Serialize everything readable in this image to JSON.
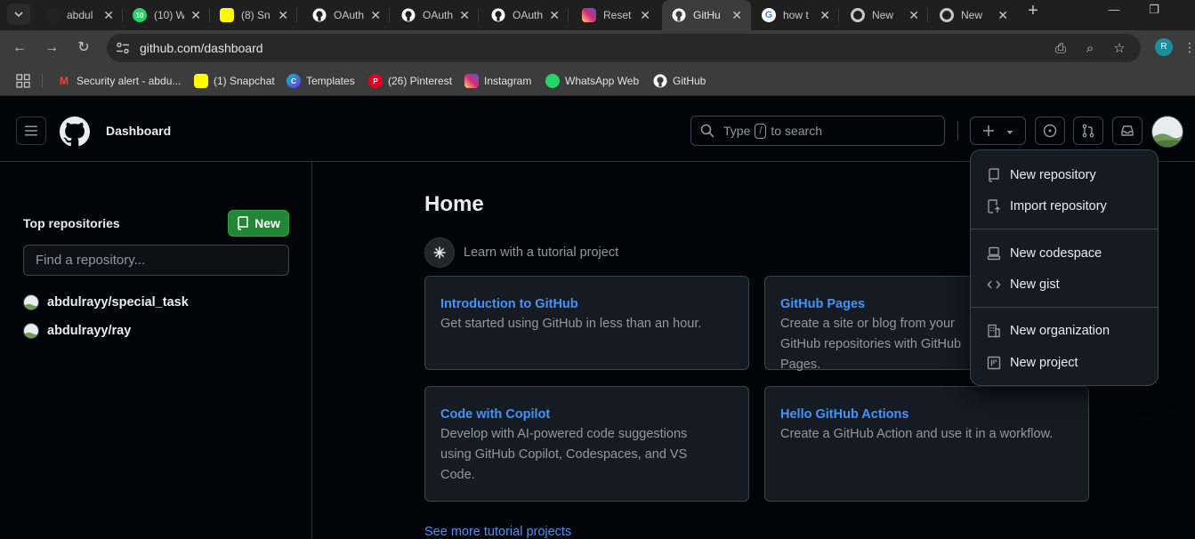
{
  "browser": {
    "tabs": [
      {
        "title": "abdul",
        "icon": "github-icon",
        "fav_color": "#111111",
        "badge": ""
      },
      {
        "title": "(10) W",
        "icon": "whatsapp-icon",
        "fav_color": "#25d366",
        "badge": "10"
      },
      {
        "title": "(8) Sn",
        "icon": "snapchat-icon",
        "fav_color": "#fffc00",
        "badge": ""
      },
      {
        "title": "OAuth",
        "icon": "github-icon",
        "fav_color": "#ffffff",
        "badge": ""
      },
      {
        "title": "OAuth",
        "icon": "github-icon",
        "fav_color": "#ffffff",
        "badge": ""
      },
      {
        "title": "OAuth",
        "icon": "github-icon",
        "fav_color": "#ffffff",
        "badge": ""
      },
      {
        "title": "Reset",
        "icon": "instagram-icon",
        "fav_color": "#d62976",
        "badge": ""
      },
      {
        "title": "GitHu",
        "icon": "github-icon",
        "fav_color": "#ffffff",
        "badge": "",
        "active": true
      },
      {
        "title": "how t",
        "icon": "google-icon",
        "fav_color": "#ffffff",
        "badge": ""
      },
      {
        "title": "New",
        "icon": "chrome-icon",
        "fav_color": "#c7c7c7",
        "badge": ""
      },
      {
        "title": "New",
        "icon": "chrome-icon",
        "fav_color": "#c7c7c7",
        "badge": ""
      }
    ],
    "url": "github.com/dashboard",
    "profile_initial": "R",
    "bookmarks": [
      {
        "label": "Security alert - abdu...",
        "icon": "gmail-icon"
      },
      {
        "label": "(1) Snapchat",
        "icon": "snapchat-icon"
      },
      {
        "label": "Templates",
        "icon": "canva-icon"
      },
      {
        "label": "(26) Pinterest",
        "icon": "pinterest-icon"
      },
      {
        "label": "Instagram",
        "icon": "instagram-icon"
      },
      {
        "label": "WhatsApp Web",
        "icon": "whatsapp-icon"
      },
      {
        "label": "GitHub",
        "icon": "github-icon"
      }
    ]
  },
  "header": {
    "context_title": "Dashboard",
    "search_prefix": "Type",
    "search_key": "/",
    "search_suffix": "to search"
  },
  "sidebar": {
    "title": "Top repositories",
    "new_button": "New",
    "find_placeholder": "Find a repository...",
    "repos": [
      {
        "owner": "abdulrayy",
        "name": "special_task"
      },
      {
        "owner": "abdulrayy",
        "name": "ray"
      }
    ]
  },
  "main": {
    "title": "Home",
    "learn_text": "Learn with a tutorial project",
    "cards": [
      {
        "title": "Introduction to GitHub",
        "desc": "Get started using GitHub in less than an hour."
      },
      {
        "title": "GitHub Pages",
        "desc": "Create a site or blog from your GitHub repositories with GitHub Pages."
      },
      {
        "title": "Code with Copilot",
        "desc": "Develop with AI-powered code suggestions using GitHub Copilot, Codespaces, and VS Code."
      },
      {
        "title": "Hello GitHub Actions",
        "desc": "Create a GitHub Action and use it in a workflow."
      }
    ],
    "see_more": "See more tutorial projects"
  },
  "create_menu": {
    "items": [
      {
        "label": "New repository",
        "icon": "repo-icon"
      },
      {
        "label": "Import repository",
        "icon": "repo-push-icon"
      },
      {
        "label": "New codespace",
        "icon": "codespaces-icon"
      },
      {
        "label": "New gist",
        "icon": "code-icon"
      },
      {
        "label": "New organization",
        "icon": "organization-icon"
      },
      {
        "label": "New project",
        "icon": "project-icon"
      }
    ]
  },
  "colors": {
    "accent_link": "#4493f8",
    "primary_button": "#238636",
    "page_bg": "#010409",
    "card_bg": "#151b23"
  }
}
